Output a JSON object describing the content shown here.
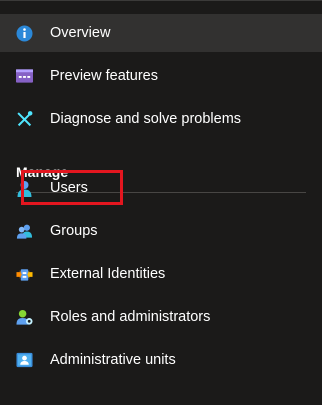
{
  "nav": {
    "items": [
      {
        "label": "Overview",
        "icon": "info-icon"
      },
      {
        "label": "Preview features",
        "icon": "preview-features-icon"
      },
      {
        "label": "Diagnose and solve problems",
        "icon": "tools-icon"
      }
    ],
    "section_title": "Manage",
    "manage_items": [
      {
        "label": "Users",
        "icon": "user-icon"
      },
      {
        "label": "Groups",
        "icon": "groups-icon"
      },
      {
        "label": "External Identities",
        "icon": "external-identities-icon"
      },
      {
        "label": "Roles and administrators",
        "icon": "roles-icon"
      },
      {
        "label": "Administrative units",
        "icon": "administrative-units-icon"
      }
    ]
  },
  "colors": {
    "background": "#1b1a19",
    "selected_background": "#323130",
    "highlight_border": "#e3161f",
    "accent_blue": "#0078d4"
  }
}
